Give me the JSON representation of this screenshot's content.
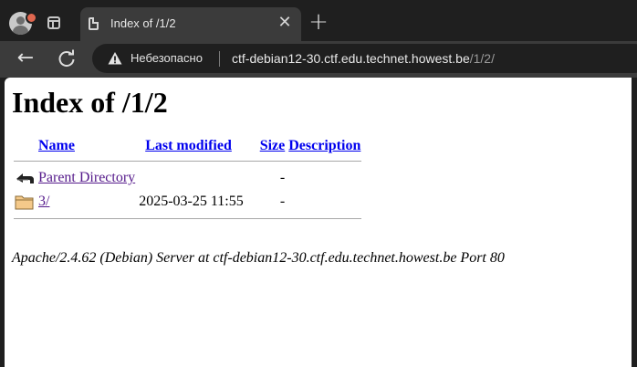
{
  "browser": {
    "tab": {
      "title": "Index of /1/2",
      "close_glyph": "✕"
    },
    "new_tab_glyph": "+",
    "back_glyph": "←",
    "security_label": "Небезопасно",
    "url_host": "ctf-debian12-30.ctf.edu.technet.howest.be",
    "url_path": "/1/2/",
    "icons": [
      "profile-icon",
      "tab-search-icon",
      "document-icon",
      "close-icon",
      "plus-icon",
      "back-arrow-icon",
      "reload-icon",
      "warning-icon"
    ],
    "colors": {
      "frame": "#1f1f1f",
      "toolbar": "#3b3b3b",
      "profile_badge": "#e0674f"
    }
  },
  "page": {
    "heading": "Index of /1/2",
    "columns": {
      "name": "Name",
      "last_modified": "Last modified",
      "size": "Size",
      "description": "Description"
    },
    "rows": [
      {
        "icon": "back-icon",
        "name": "Parent Directory",
        "last_modified": "",
        "size": "-",
        "description": ""
      },
      {
        "icon": "folder-icon",
        "name": "3/",
        "last_modified": "2025-03-25 11:55",
        "size": "-",
        "description": ""
      }
    ],
    "footer": "Apache/2.4.62 (Debian) Server at ctf-debian12-30.ctf.edu.technet.howest.be Port 80",
    "colors": {
      "link": "#0000ee",
      "visited_link": "#551a8b"
    }
  }
}
